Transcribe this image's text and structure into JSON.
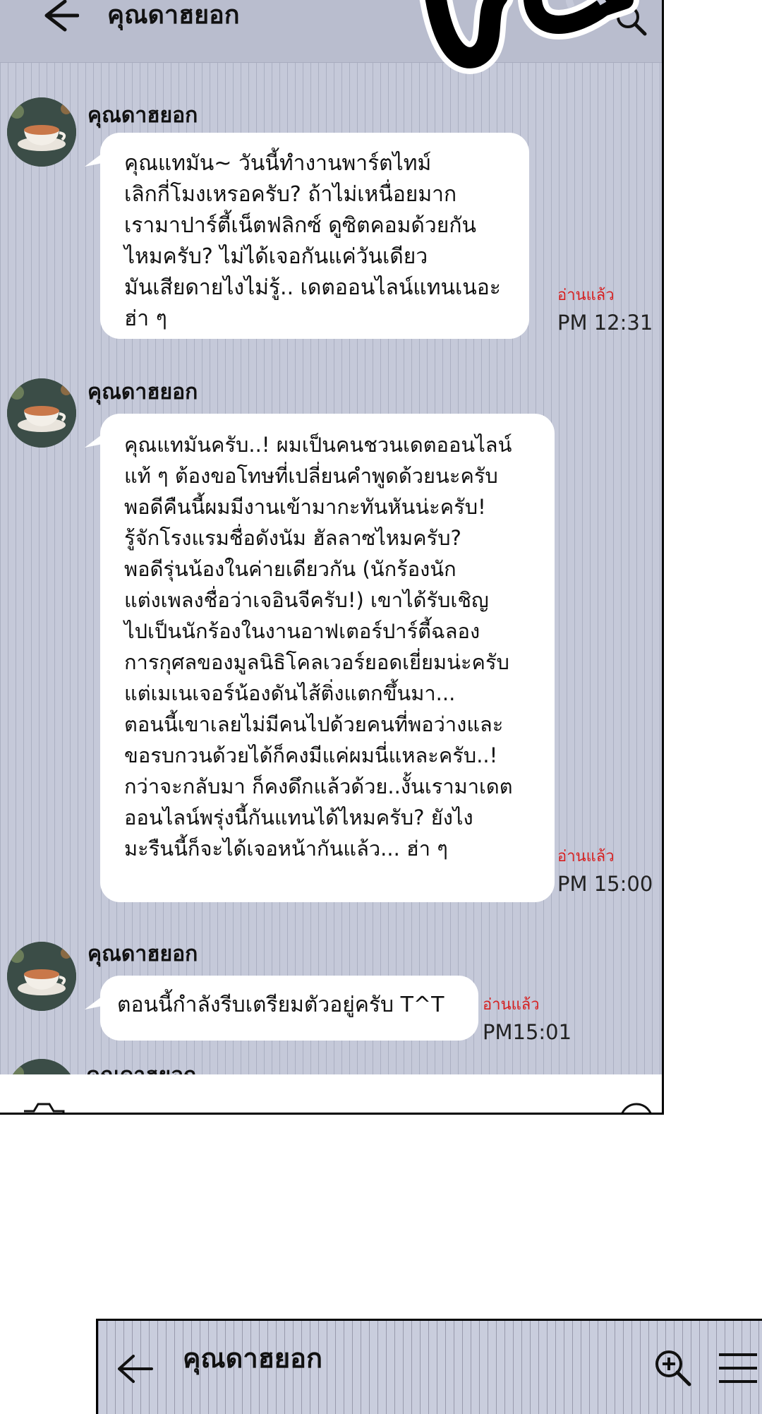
{
  "chat": {
    "title": "คุณดาฮยอก",
    "messages": [
      {
        "sender": "คุณดาฮยอก",
        "lines": [
          "คุณแทมัน~ วันนี้ทำงานพาร์ตไทม์",
          "เลิกกี่โมงเหรอครับ? ถ้าไม่เหนื่อยมาก",
          "เรามาปาร์ตี้เน็ตฟลิกซ์ ดูซิตคอมด้วยกัน",
          "ไหมครับ? ไม่ได้เจอกันแค่วันเดียว",
          "มันเสียดายไงไม่รู้.. เดตออนไลน์แทนเนอะ",
          "ฮ่า ๆ"
        ],
        "read": "อ่านแล้ว",
        "time": "PM 12:31"
      },
      {
        "sender": "คุณดาฮยอก",
        "lines": [
          "คุณแทมันครับ..! ผมเป็นคนชวนเดตออนไลน์",
          "แท้ ๆ ต้องขอโทษที่เปลี่ยนคำพูดด้วยนะครับ",
          "พอดีคืนนี้ผมมีงานเข้ามากะทันหันน่ะครับ!",
          "รู้จักโรงแรมชื่อดังนัม ฮัลลาซไหมครับ?",
          "พอดีรุ่นน้องในค่ายเดียวกัน (นักร้องนัก",
          "แต่งเพลงชื่อว่าเจอินจีครับ!) เขาได้รับเชิญ",
          "ไปเป็นนักร้องในงานอาฟเตอร์ปาร์ตี้ฉลอง",
          "การกุศลของมูลนิธิโคลเวอร์ยอดเยี่ยมน่ะครับ",
          "แต่เมเนเจอร์น้องดันไส้ติ่งแตกขึ้นมา...",
          "ตอนนี้เขาเลยไม่มีคนไปด้วยคนที่พอว่างและ",
          "ขอรบกวนด้วยได้ก็คงมีแค่ผมนี่แหละครับ..!",
          "กว่าจะกลับมา ก็คงดึกแล้วด้วย..งั้นเรามาเดต",
          "ออนไลน์พรุ่งนี้กันแทนได้ไหมครับ? ยังไง",
          "มะรืนนี้ก็จะได้เจอหน้ากันแล้ว... ฮ่า ๆ"
        ],
        "read": "อ่านแล้ว",
        "time": "PM 15:00"
      },
      {
        "sender": "คุณดาฮยอก",
        "lines": [
          "ตอนนี้กำลังรีบเตรียมตัวอยู่ครับ T^T"
        ],
        "read": "อ่านแล้ว",
        "time": "PM15:01"
      },
      {
        "sender": "คุณดาฮยอก"
      }
    ]
  },
  "next_panel": {
    "title": "คุณดาฮยอก"
  },
  "colors": {
    "chat_background": "#c5c9d9",
    "bubble": "#ffffff",
    "read_receipt": "#d62020"
  },
  "icons": [
    "back-arrow-icon",
    "zoom-in-icon",
    "menu-icon",
    "camera-icon",
    "emoji-icon"
  ]
}
